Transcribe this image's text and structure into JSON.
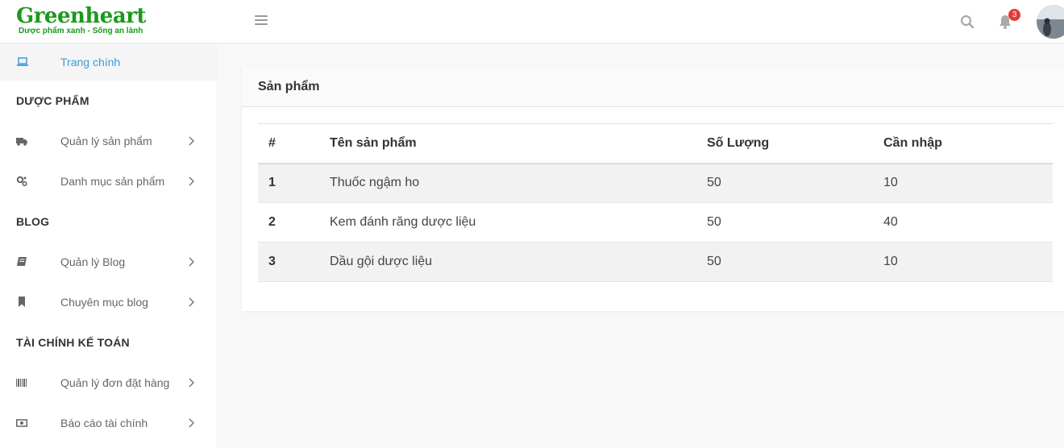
{
  "brand": {
    "name": "Greenheart",
    "tagline": "Dược phẩm xanh - Sống an lành",
    "color": "#1a9a1a"
  },
  "topbar": {
    "notification_count": "3",
    "icons": [
      "menu-icon",
      "search-icon",
      "bell-icon"
    ]
  },
  "sidebar": {
    "home_label": "Trang chính",
    "sections": {
      "pharma": "DƯỢC PHẨM",
      "blog": "BLOG",
      "finance": "TÀI CHÍNH KẾ TOÁN"
    },
    "items": {
      "product_mgmt": "Quản lý sản phẩm",
      "product_category": "Danh mục sản phẩm",
      "blog_mgmt": "Quản lý Blog",
      "blog_category": "Chuyên mục blog",
      "order_mgmt": "Quản lý đơn đặt hàng",
      "finance_report": "Báo cáo tài chính"
    }
  },
  "main": {
    "card_title": "Sản phẩm",
    "table": {
      "headers": [
        "#",
        "Tên sản phẩm",
        "Số Lượng",
        "Cần nhập"
      ],
      "rows": [
        [
          "1",
          "Thuốc ngậm ho",
          "50",
          "10"
        ],
        [
          "2",
          "Kem đánh răng dược liệu",
          "50",
          "40"
        ],
        [
          "3",
          "Dầu gội dược liệu",
          "50",
          "10"
        ]
      ]
    }
  },
  "colors": {
    "accent": "#3a9bd8",
    "badge": "#e53935"
  }
}
